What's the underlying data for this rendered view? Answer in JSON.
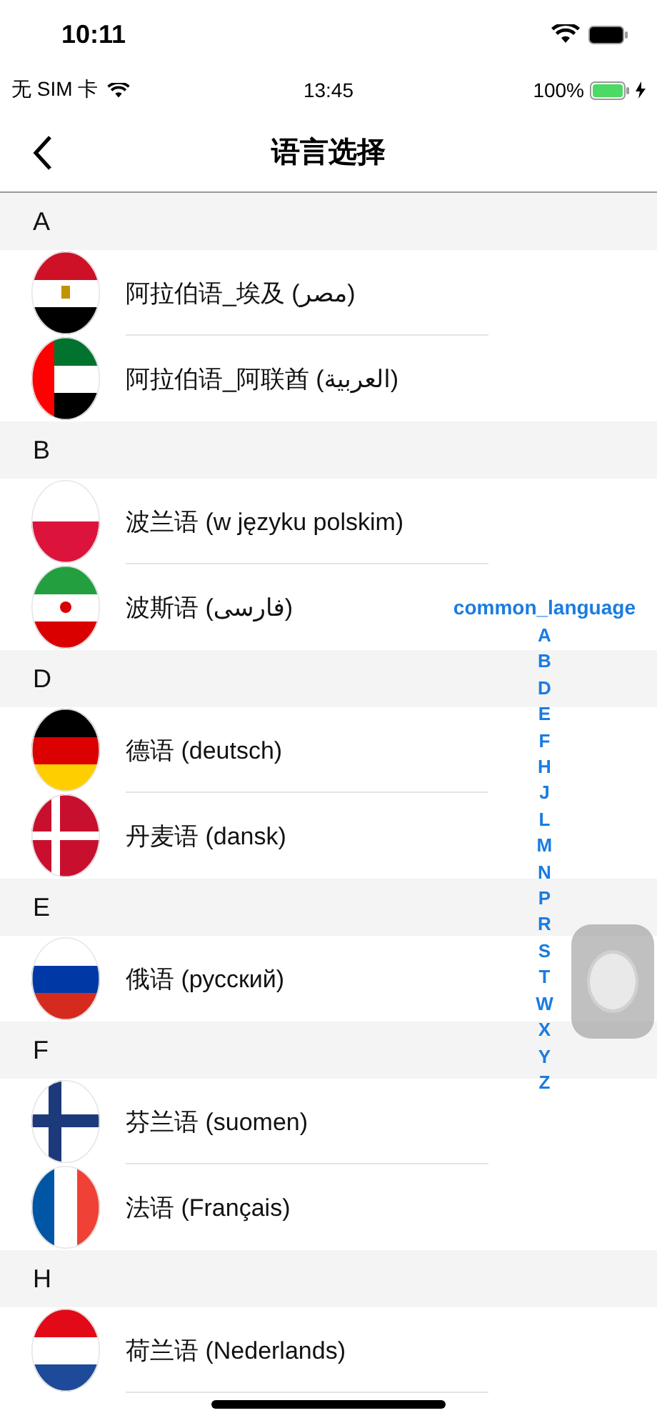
{
  "device_status": {
    "time": "10:11"
  },
  "status_bar": {
    "carrier": "无 SIM 卡",
    "time": "13:45",
    "battery": "100%"
  },
  "nav": {
    "title": "语言选择"
  },
  "sections": [
    {
      "letter": "A",
      "items": [
        {
          "name": "阿拉伯语_埃及 (مصر)",
          "kind": "egypt"
        },
        {
          "name": "阿拉伯语_阿联酋 (العربية)",
          "kind": "uae"
        }
      ]
    },
    {
      "letter": "B",
      "items": [
        {
          "name": "波兰语 (w języku polskim)",
          "kind": "poland"
        },
        {
          "name": "波斯语 (فارسی)",
          "kind": "iran"
        }
      ]
    },
    {
      "letter": "D",
      "items": [
        {
          "name": "德语 (deutsch)",
          "kind": "germany"
        },
        {
          "name": "丹麦语 (dansk)",
          "kind": "denmark"
        }
      ]
    },
    {
      "letter": "E",
      "items": [
        {
          "name": "俄语 (русский)",
          "kind": "russia"
        }
      ]
    },
    {
      "letter": "F",
      "items": [
        {
          "name": "芬兰语 (suomen)",
          "kind": "finland"
        },
        {
          "name": "法语 (Français)",
          "kind": "france"
        }
      ]
    },
    {
      "letter": "H",
      "items": [
        {
          "name": "荷兰语 (Nederlands)",
          "kind": "netherlands"
        }
      ]
    }
  ],
  "index": [
    "common_language",
    "A",
    "B",
    "D",
    "E",
    "F",
    "H",
    "J",
    "L",
    "M",
    "N",
    "P",
    "R",
    "S",
    "T",
    "W",
    "X",
    "Y",
    "Z"
  ]
}
